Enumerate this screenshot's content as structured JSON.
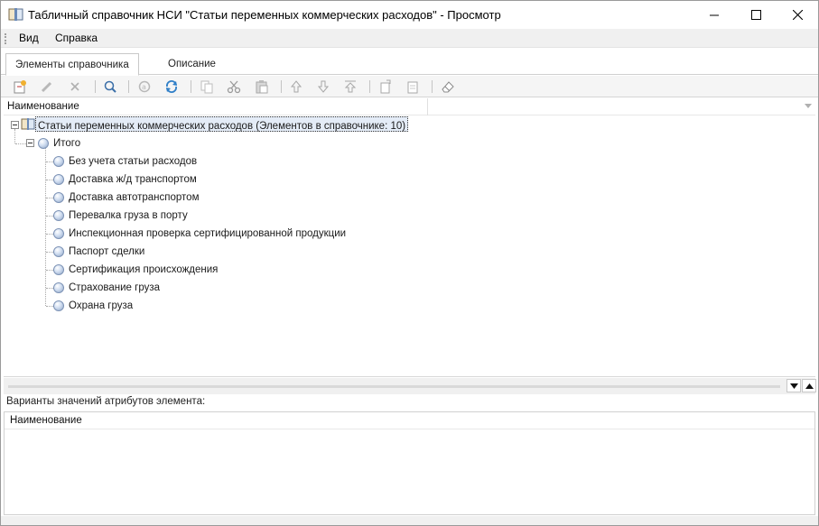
{
  "window": {
    "title": "Табличный справочник НСИ \"Статьи переменных коммерческих расходов\" - Просмотр",
    "icon": "book-icon"
  },
  "menu": {
    "items": [
      "Вид",
      "Справка"
    ]
  },
  "tabs": [
    {
      "label": "Элементы справочника",
      "active": true
    },
    {
      "label": "Описание",
      "active": false
    }
  ],
  "toolbar": {
    "buttons": [
      "new-element-icon",
      "edit-icon",
      "delete-icon",
      "find-icon",
      "sync-icon",
      "refresh-icon",
      "copy-icon",
      "cut-icon",
      "paste-icon",
      "move-up-icon",
      "move-down-icon",
      "move-top-icon",
      "export-icon",
      "import-icon",
      "clear-icon"
    ]
  },
  "tree": {
    "column": "Наименование",
    "root": "Статьи переменных коммерческих расходов (Элементов в справочнике: 10)",
    "group": "Итого",
    "items": [
      "Без учета статьи расходов",
      "Доставка ж/д транспортом",
      "Доставка автотранспортом",
      "Перевалка груза в порту",
      "Инспекционная проверка сертифицированной продукции",
      "Паспорт сделки",
      "Сертификация происхождения",
      "Страхование груза",
      "Охрана груза"
    ]
  },
  "attributes": {
    "label": "Варианты значений атрибутов элемента:",
    "column": "Наименование"
  },
  "colors": {
    "selection": "#e4ecf7",
    "node_ball": "#8fa6c8"
  }
}
